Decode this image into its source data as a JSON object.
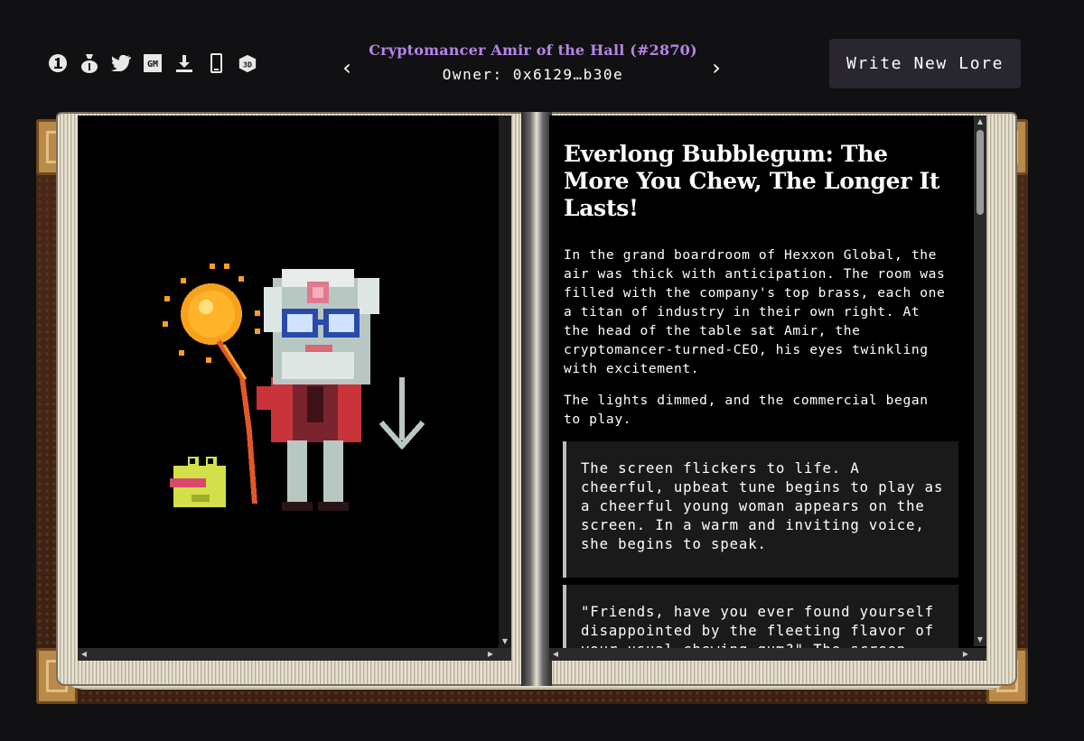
{
  "header": {
    "title": "Cryptomancer Amir of the Hall (#2870)",
    "owner": "Owner: 0x6129…b30e",
    "write_button": "Write New Lore",
    "prev_arrow": "‹",
    "next_arrow": "›"
  },
  "toolbar_icons": [
    {
      "name": "number-one-icon"
    },
    {
      "name": "money-bag-icon"
    },
    {
      "name": "twitter-icon"
    },
    {
      "name": "gm-icon",
      "label": "GM"
    },
    {
      "name": "download-icon"
    },
    {
      "name": "phone-icon"
    },
    {
      "name": "3d-icon",
      "label": "3D"
    }
  ],
  "lore": {
    "heading": "Everlong Bubblegum: The More You Chew, The Longer It Lasts!",
    "paragraphs": [
      "In the grand boardroom of Hexxon Global, the air was thick with anticipation. The room was filled with the company's top brass, each one a titan of industry in their own right. At the head of the table sat Amir, the cryptomancer-turned-CEO, his eyes twinkling with excitement.",
      "The lights dimmed, and the commercial began to play."
    ],
    "quotes": [
      "The screen flickers to life. A cheerful, upbeat tune begins to play as a cheerful young woman appears on the screen. In a warm and inviting voice, she begins to speak.",
      "\"Friends, have you ever found yourself disappointed by the fleeting flavor of your usual chewing gum?\" The screen shows a"
    ]
  },
  "colors": {
    "background": "#111012",
    "title_purple": "#b685e6",
    "button_bg": "#2a2630",
    "page_bg": "#000000"
  }
}
